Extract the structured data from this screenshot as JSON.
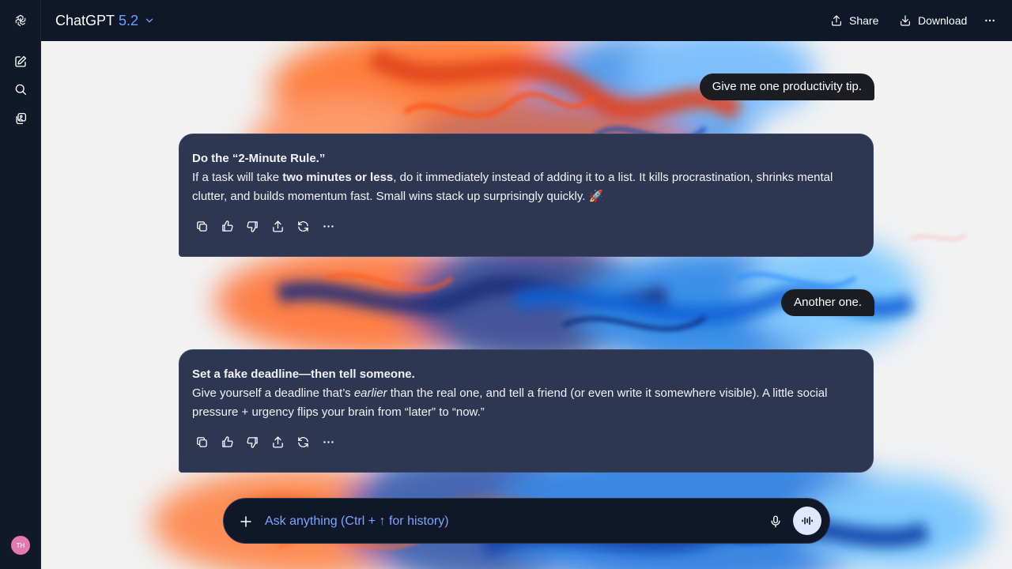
{
  "app": {
    "model_name": "ChatGPT",
    "model_version": "5.2"
  },
  "sidebar": {
    "logo_icon": "openai-logo-icon",
    "items": [
      {
        "icon": "new-chat-icon"
      },
      {
        "icon": "search-icon"
      },
      {
        "icon": "library-icon"
      }
    ],
    "avatar_initials": "TH"
  },
  "header": {
    "share_label": "Share",
    "download_label": "Download",
    "more_icon": "more-horizontal-icon"
  },
  "messages": [
    {
      "role": "user",
      "text": "Give me one productivity tip."
    },
    {
      "role": "assistant",
      "heading": "Do the “2-Minute Rule.”",
      "p1_a": "If a task will take ",
      "p1_b": "two minutes or less",
      "p1_c": ", do it immediately instead of adding it to a list. It kills procrastination, shrinks mental clutter, and builds momentum fast. Small wins stack up surprisingly quickly. 🚀"
    },
    {
      "role": "user",
      "text": "Another one."
    },
    {
      "role": "assistant",
      "heading": "Set a fake deadline—then tell someone.",
      "p1_a": "Give yourself a deadline that’s ",
      "p1_b": "earlier",
      "p1_c": " than the real one, and tell a friend (or even write it somewhere visible). A little social pressure + urgency flips your brain from “later” to “now.”"
    }
  ],
  "message_actions": [
    "copy-icon",
    "thumbs-up-icon",
    "thumbs-down-icon",
    "share-icon",
    "regenerate-icon",
    "more-horizontal-icon"
  ],
  "composer": {
    "placeholder": "Ask anything (Ctrl + ↑ for history)",
    "value": ""
  },
  "colors": {
    "app_bg": "#111827",
    "assistant_card": "#2d3752",
    "user_bubble": "#1b1d22",
    "accent_version": "#6ea0ff",
    "placeholder": "#7ea5ff"
  }
}
